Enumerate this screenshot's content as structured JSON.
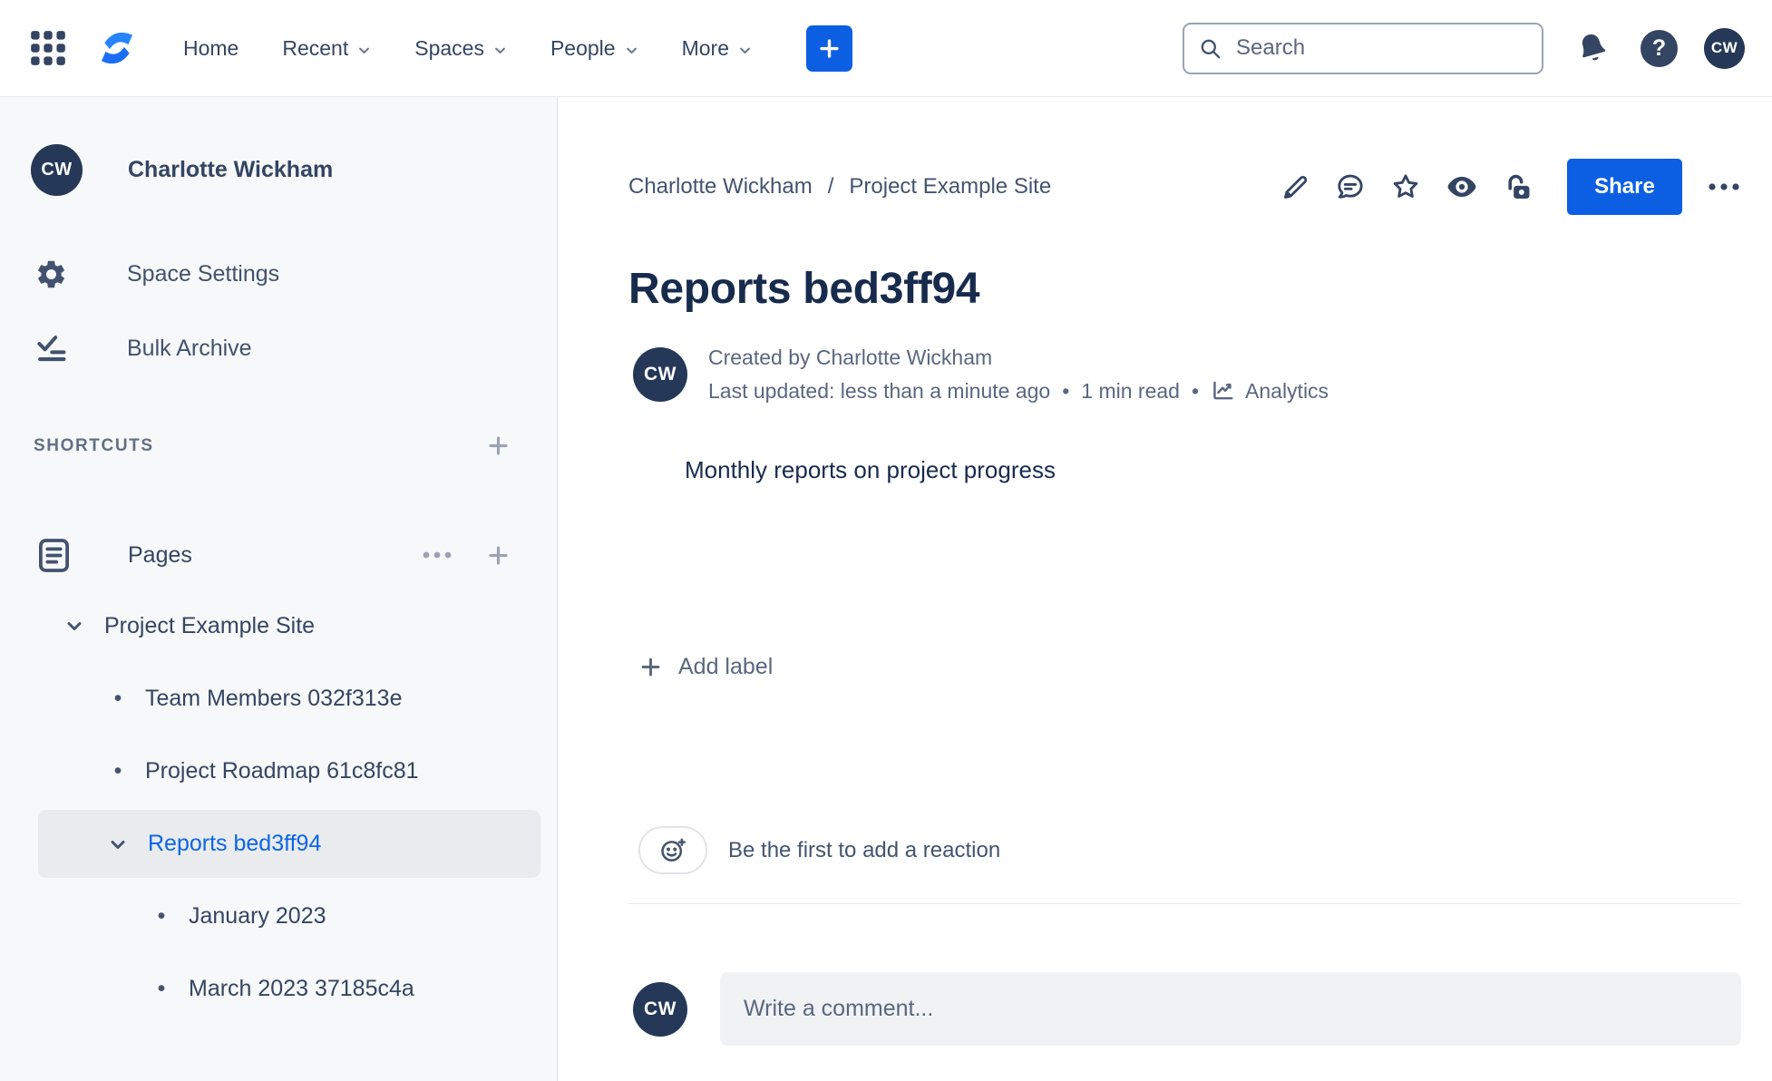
{
  "topnav": {
    "nav_items": [
      {
        "label": "Home"
      },
      {
        "label": "Recent"
      },
      {
        "label": "Spaces"
      },
      {
        "label": "People"
      },
      {
        "label": "More"
      }
    ],
    "search": {
      "placeholder": "Search"
    },
    "help_glyph": "?",
    "avatar_initials": "CW"
  },
  "sidebar": {
    "space_avatar_initials": "CW",
    "space_name": "Charlotte Wickham",
    "menu_items": [
      {
        "label": "Space Settings"
      },
      {
        "label": "Bulk Archive"
      }
    ],
    "shortcuts_header": "SHORTCUTS",
    "pages_label": "Pages",
    "tree": [
      {
        "label": "Project Example Site",
        "level": 0,
        "expanded": true
      },
      {
        "label": "Team Members 032f313e",
        "level": 1
      },
      {
        "label": "Project Roadmap 61c8fc81",
        "level": 1
      },
      {
        "label": "Reports bed3ff94",
        "level": 1,
        "expanded": true,
        "selected": true
      },
      {
        "label": "January 2023",
        "level": 2
      },
      {
        "label": "March 2023 37185c4a",
        "level": 2
      }
    ]
  },
  "content": {
    "breadcrumbs": [
      {
        "label": "Charlotte Wickham"
      },
      {
        "label": "Project Example Site"
      }
    ],
    "breadcrumb_separator": "/",
    "toolbar": {
      "share_label": "Share",
      "icon_actions": [
        "edit",
        "comments",
        "star",
        "watch",
        "restrictions",
        "more-actions"
      ]
    },
    "page_title": "Reports bed3ff94",
    "byline": {
      "avatar_initials": "CW",
      "created": "Created by Charlotte Wickham",
      "updated": "Last updated: less than a minute ago",
      "separator": "•",
      "read_time": "1 min read",
      "analytics_label": "Analytics"
    },
    "body_text": "Monthly reports on project progress",
    "add_label_text": "Add label",
    "reaction_prompt": "Be the first to add a reaction",
    "comment": {
      "avatar_initials": "CW",
      "placeholder": "Write a comment..."
    }
  },
  "colors": {
    "accent_blue": "#0C5FE3",
    "selected_link_blue": "#0C66E4",
    "navy_text": "#344563",
    "title_text": "#172B4D",
    "muted_text": "#596780",
    "sidebar_bg": "#F7F8F9",
    "selected_row_bg": "#E9EBEF",
    "avatar_bg": "#253858"
  }
}
